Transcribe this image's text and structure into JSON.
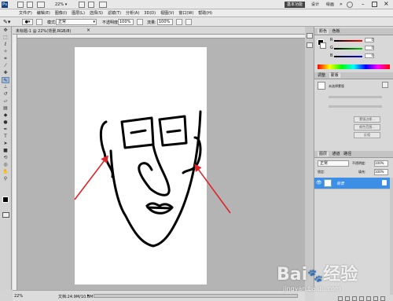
{
  "top": {
    "zoom": "22%",
    "workspace": "基本功能",
    "design": "设计",
    "paint": "绘画"
  },
  "menu": [
    "文件(F)",
    "编辑(E)",
    "图像(I)",
    "图层(L)",
    "选择(S)",
    "滤镜(T)",
    "分析(A)",
    "3D(D)",
    "视图(V)",
    "窗口(W)",
    "帮助(H)"
  ],
  "options": {
    "mode_label": "模式:",
    "mode_value": "正常",
    "opacity_label": "不透明度:",
    "opacity_value": "100%",
    "flow_label": "流量:",
    "flow_value": "100%"
  },
  "document": {
    "tab_title": "未标题-1 @ 22%(背景,RGB/8)"
  },
  "status": {
    "zoom": "22%",
    "doc_size": "文档:24.9M/10.8M"
  },
  "panels": {
    "color_tab": "颜色",
    "swatches_tab": "色板",
    "adjust_tab": "调整",
    "masks_tab": "蒙版",
    "mask_title": "未选择蒙版",
    "mask_btns": [
      "蒙版边缘...",
      "颜色范围...",
      "反相"
    ],
    "layers_tab": "图层",
    "channels_tab": "通道",
    "paths_tab": "路径",
    "blend_mode": "正常",
    "opacity_label": "不透明度:",
    "opacity_value": "100%",
    "lock_label": "锁定:",
    "fill_label": "填充:",
    "fill_value": "100%",
    "layer_name": "背景"
  },
  "colors": {
    "accent": "#3d8ee5",
    "selected_layer": "#3d8ee5",
    "arrow": "#e0222a"
  },
  "watermark": "Bai经验 jingyan.baidu.com"
}
